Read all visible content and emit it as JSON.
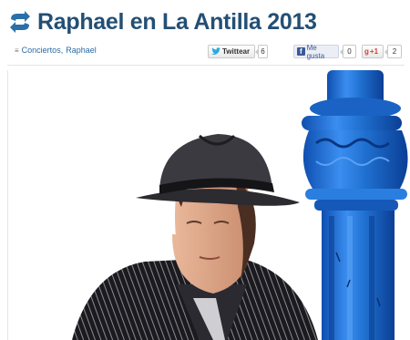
{
  "post": {
    "title": "Raphael en La Antilla 2013",
    "title_icon": "repost-arrows-icon",
    "categories_icon": "folder-icon",
    "categories": [
      "Conciertos",
      "Raphael"
    ],
    "category_separator": ","
  },
  "share": {
    "twitter": {
      "label": "Twittear",
      "count": "6",
      "icon": "twitter-bird-icon"
    },
    "facebook": {
      "label": "Me gusta",
      "count": "0",
      "icon": "facebook-icon"
    },
    "google": {
      "label": "+1",
      "count": "2",
      "icon": "google-plus-icon"
    }
  },
  "colors": {
    "title": "#234f75",
    "link": "#2a6aa5",
    "lamppost_blue": "#1f6fcf",
    "facebook": "#3b5998",
    "twitter": "#2aa9e0",
    "google": "#d23f31"
  },
  "image": {
    "subject": "man in black fedora and pinstripe suit beside blue lamppost"
  }
}
